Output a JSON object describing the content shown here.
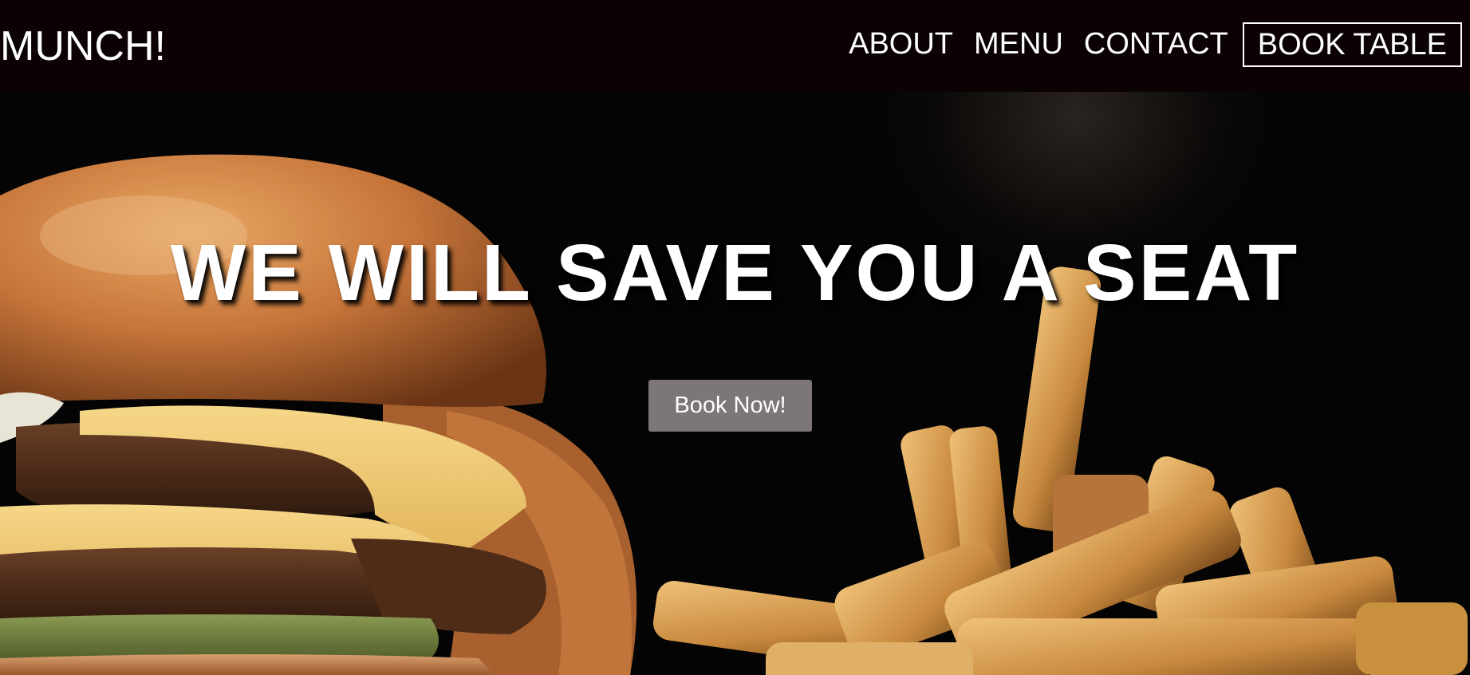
{
  "header": {
    "logo": "MUNCH!",
    "nav": [
      {
        "label": "ABOUT"
      },
      {
        "label": "MENU"
      },
      {
        "label": "CONTACT"
      }
    ],
    "cta_label": "BOOK TABLE"
  },
  "hero": {
    "title": "WE WILL SAVE YOU A SEAT",
    "button_label": "Book Now!",
    "image": "burger-and-fries-photo"
  },
  "colors": {
    "navbar_bg": "#0c0204",
    "text": "#ffffff",
    "button_bg": "#7d7677"
  }
}
